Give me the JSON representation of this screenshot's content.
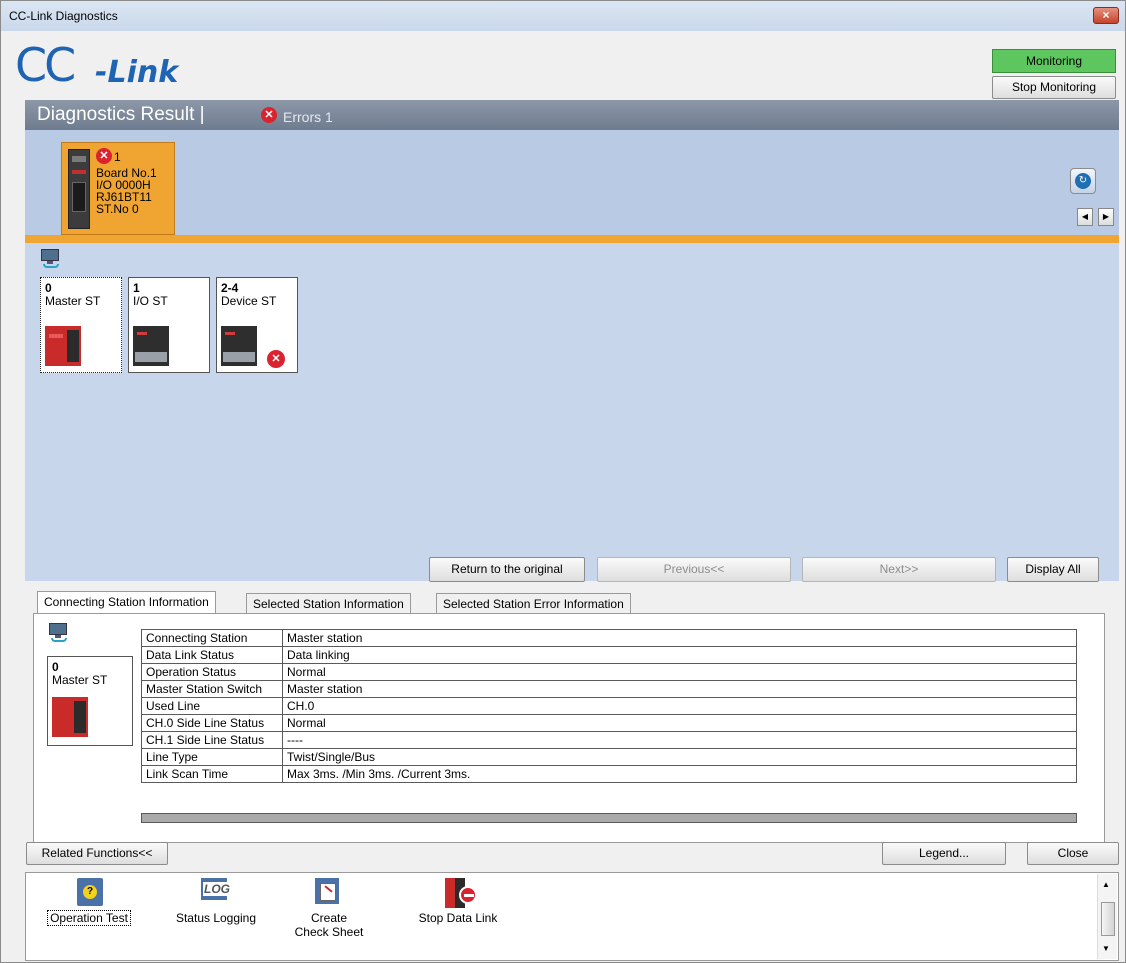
{
  "window": {
    "title": "CC-Link Diagnostics",
    "close": "×"
  },
  "logo": {
    "cc": "CC",
    "link": "-Link"
  },
  "monitoring": {
    "status": "Monitoring",
    "stop_button": "Stop Monitoring"
  },
  "diagnostics": {
    "title": "Diagnostics Result |",
    "errors": "Errors 1"
  },
  "board": {
    "error_count": "1",
    "line1": "Board No.1",
    "line2": "I/O 0000H",
    "line3": "RJ61BT11",
    "line4": "ST.No 0"
  },
  "stations": [
    {
      "num": "0",
      "label": "Master ST"
    },
    {
      "num": "1",
      "label": "I/O ST"
    },
    {
      "num": "2-4",
      "label": "Device ST"
    }
  ],
  "nav_buttons": {
    "return": "Return to the original",
    "previous": "Previous<<",
    "next": "Next>>",
    "display_all": "Display All"
  },
  "tabs": [
    "Connecting Station Information",
    "Selected Station Information",
    "Selected Station Error Information"
  ],
  "connecting_station": {
    "num": "0",
    "label": "Master ST"
  },
  "info_rows": [
    [
      "Connecting Station",
      "Master station"
    ],
    [
      "Data Link Status",
      "Data linking"
    ],
    [
      "Operation Status",
      "Normal"
    ],
    [
      "Master Station Switch",
      "Master station"
    ],
    [
      "Used Line",
      "CH.0"
    ],
    [
      "CH.0 Side Line Status",
      "Normal"
    ],
    [
      "CH.1 Side Line Status",
      "----"
    ],
    [
      "Line Type",
      "Twist/Single/Bus"
    ],
    [
      "Link Scan Time",
      "Max 3ms. /Min 3ms. /Current 3ms."
    ]
  ],
  "bottom": {
    "related": "Related Functions<<",
    "legend": "Legend...",
    "close": "Close"
  },
  "functions": [
    {
      "label": "Operation Test"
    },
    {
      "label": "Status Logging"
    },
    {
      "label": "Create Check Sheet"
    },
    {
      "label": "Stop Data Link"
    }
  ],
  "colors": {
    "accent_orange": "#f0a532",
    "monitoring_green": "#5ec65e",
    "error_red": "#d9232e",
    "panel_blue": "#c8d6ec"
  }
}
